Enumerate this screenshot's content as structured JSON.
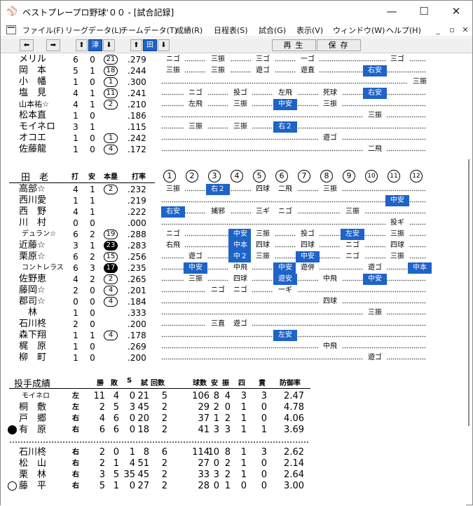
{
  "window": {
    "title": "ベストプレープロ野球'００ - [試合記録]",
    "app_icon": "baseball-app-icon",
    "controls": [
      "—",
      "☐",
      "✕"
    ]
  },
  "menu": [
    "ファイル(F)",
    "リーグデータ(L)",
    "チームデータ(T)",
    "成績(R)",
    "日程表(S)",
    "試合(G)",
    "表示(V)",
    "ウィンドウ(W)",
    "ヘルプ(H)"
  ],
  "mdi_controls": [
    "_",
    "▫",
    "✕"
  ],
  "toolbar": {
    "team1": "津",
    "team2": "田",
    "replay": "再生",
    "save": "保存"
  },
  "team_top": {
    "batters": [
      {
        "name": "メリル",
        "ab": "6",
        "h": "0",
        "hr": "21",
        "avg": ".279",
        "hr_fill": false,
        "results": [
          "ニゴ",
          "三振",
          "三ゴ",
          "捕邪",
          "",
          "三ゴ",
          "一ゴ"
        ]
      },
      {
        "name": "岡　本",
        "ab": "5",
        "h": "1",
        "hr": "18",
        "avg": ".244",
        "results": [
          "三振",
          "三振",
          "遊ゴ",
          "遊直",
          "右安"
        ]
      },
      {
        "name": "小　幡",
        "ab": "1",
        "h": "0",
        "hr": "1",
        "avg": ".300",
        "results": [
          "三振"
        ]
      },
      {
        "name": "塩　見",
        "ab": "4",
        "h": "1",
        "hr": "11",
        "avg": ".241",
        "results": [
          "ニゴ",
          "投ゴ",
          "左飛",
          "死球",
          "右安"
        ]
      },
      {
        "name": "山本祐☆",
        "ab": "4",
        "h": "1",
        "hr": "2",
        "avg": ".210",
        "results": [
          "左飛",
          "三振",
          "中安",
          "三振"
        ]
      },
      {
        "name": "松本直",
        "ab": "1",
        "h": "0",
        "hr": "",
        "avg": ".186",
        "results": [
          "三振"
        ]
      },
      {
        "name": "モイネロ",
        "ab": "3",
        "h": "1",
        "hr": "",
        "avg": ".115",
        "results": [
          "三振",
          "三振",
          "右２"
        ]
      },
      {
        "name": "オコエ",
        "ab": "1",
        "h": "0",
        "hr": "1",
        "avg": ".242",
        "results": [
          "遊ゴ"
        ]
      },
      {
        "name": "佐藤龍",
        "ab": "1",
        "h": "0",
        "hr": "4",
        "avg": ".172",
        "results": [
          "二飛"
        ]
      }
    ]
  },
  "team_bottom": {
    "name": "田　老",
    "headers": {
      "ab": "打",
      "h": "安",
      "hr": "本塁",
      "avg": "打率"
    },
    "innings": [
      "1",
      "2",
      "3",
      "4",
      "5",
      "6",
      "7",
      "8",
      "9",
      "10",
      "11",
      "12"
    ],
    "batters": [
      {
        "name": "高部☆",
        "ab": "4",
        "h": "1",
        "hr": "2",
        "avg": ".232",
        "results": [
          "三振",
          "右２",
          "四球",
          "二飛",
          "三振"
        ]
      },
      {
        "name": "西川愛",
        "ab": "1",
        "h": "1",
        "hr": "",
        "avg": ".219",
        "results": [
          "中安"
        ]
      },
      {
        "name": "西　野",
        "ab": "4",
        "h": "1",
        "hr": "",
        "avg": ".222",
        "results": [
          "右安",
          "捕邪",
          "三ギ",
          "ニゴ",
          "三振"
        ]
      },
      {
        "name": "川　村",
        "ab": "0",
        "h": "0",
        "hr": "",
        "avg": ".000",
        "results": [
          "投ギ"
        ]
      },
      {
        "name": "デュラン☆",
        "ab": "6",
        "h": "2",
        "hr": "19",
        "avg": ".288",
        "results": [
          "ニゴ",
          "中安",
          "三振",
          "投ゴ",
          "左安",
          "三振"
        ]
      },
      {
        "name": "近藤☆",
        "ab": "3",
        "h": "1",
        "hr": "23",
        "avg": ".283",
        "hr_fill": true,
        "results": [
          "右飛",
          "中本",
          "四球",
          "四球",
          "ニゴ",
          "四球"
        ]
      },
      {
        "name": "栗原☆",
        "ab": "6",
        "h": "2",
        "hr": "15",
        "avg": ".256",
        "results": [
          "遊ゴ",
          "中２",
          "三振",
          "中安",
          "ニゴ",
          "三振"
        ]
      },
      {
        "name": "コントレラス",
        "ab": "6",
        "h": "3",
        "hr": "17",
        "avg": ".235",
        "hr_fill": true,
        "results": [
          "中安",
          "中飛",
          "中安",
          "遊併",
          "遊ゴ",
          "中本"
        ]
      },
      {
        "name": "佐野恵",
        "ab": "4",
        "h": "2",
        "hr": "2",
        "avg": ".265",
        "results": [
          "三振",
          "四球",
          "遊安",
          "中飛",
          "中安"
        ]
      },
      {
        "name": "藤岡☆",
        "ab": "2",
        "h": "0",
        "hr": "4",
        "avg": ".201",
        "results": [
          "ニゴ",
          "ニゴ",
          "一ギ"
        ]
      },
      {
        "name": "郡司☆",
        "ab": "0",
        "h": "0",
        "hr": "4",
        "avg": ".184",
        "results": [
          "四球"
        ]
      },
      {
        "name": "　林",
        "ab": "1",
        "h": "0",
        "hr": "",
        "avg": ".333",
        "results": [
          "三振"
        ]
      },
      {
        "name": "石川柊",
        "ab": "2",
        "h": "0",
        "hr": "",
        "avg": ".200",
        "results": [
          "三直",
          "遊ゴ"
        ]
      },
      {
        "name": "森下翔",
        "ab": "1",
        "h": "1",
        "hr": "4",
        "avg": ".178",
        "results": [
          "左安"
        ]
      },
      {
        "name": "梶　原",
        "ab": "1",
        "h": "0",
        "hr": "",
        "avg": ".269",
        "results": [
          "中飛"
        ]
      },
      {
        "name": "柳　町",
        "ab": "1",
        "h": "0",
        "hr": "",
        "avg": ".200",
        "results": [
          "遊ゴ"
        ]
      }
    ]
  },
  "pitching": {
    "title": "投手成績",
    "headers": [
      "勝",
      "敗",
      "S",
      "試",
      "回数",
      "球数",
      "安",
      "振",
      "四",
      "責",
      "防御率"
    ],
    "team_a": [
      {
        "name": "モイネロ",
        "hand": "左",
        "w": "11",
        "l": "4",
        "s": "0",
        "g": "21",
        "ip": "5",
        "np": "106",
        "h": "8",
        "k": "4",
        "bb": "3",
        "er": "3",
        "era": "2.47",
        "mark": ""
      },
      {
        "name": "桐　敷",
        "hand": "左",
        "w": "2",
        "l": "5",
        "s": "3",
        "g": "45",
        "ip": "2",
        "np": "29",
        "h": "2",
        "k": "0",
        "bb": "1",
        "er": "0",
        "era": "4.78",
        "mark": ""
      },
      {
        "name": "戸　郷",
        "hand": "右",
        "w": "4",
        "l": "6",
        "s": "0",
        "g": "20",
        "ip": "2",
        "np": "37",
        "h": "1",
        "k": "2",
        "bb": "1",
        "er": "0",
        "era": "4.06",
        "mark": ""
      },
      {
        "name": "有　原",
        "hand": "右",
        "w": "6",
        "l": "6",
        "s": "0",
        "g": "18",
        "ip": "2",
        "np": "41",
        "h": "3",
        "k": "3",
        "bb": "1",
        "er": "1",
        "era": "3.69",
        "mark": "loss"
      }
    ],
    "team_b": [
      {
        "name": "石川柊",
        "hand": "右",
        "w": "2",
        "l": "0",
        "s": "1",
        "g": "8",
        "ip": "6",
        "np": "114",
        "h": "10",
        "k": "8",
        "bb": "1",
        "er": "3",
        "era": "2.62",
        "mark": ""
      },
      {
        "name": "松　山",
        "hand": "右",
        "w": "2",
        "l": "1",
        "s": "4",
        "g": "51",
        "ip": "2",
        "np": "27",
        "h": "0",
        "k": "2",
        "bb": "1",
        "er": "0",
        "era": "2.14",
        "mark": ""
      },
      {
        "name": "栗　林",
        "hand": "右",
        "w": "3",
        "l": "5",
        "s": "35",
        "g": "45",
        "ip": "2",
        "np": "33",
        "h": "3",
        "k": "2",
        "bb": "1",
        "er": "0",
        "era": "2.64",
        "mark": ""
      },
      {
        "name": "藤　平",
        "hand": "右",
        "w": "5",
        "l": "1",
        "s": "0",
        "g": "27",
        "ip": "2",
        "np": "28",
        "h": "0",
        "k": "1",
        "bb": "0",
        "er": "0",
        "era": "3.00",
        "mark": "win"
      }
    ]
  }
}
